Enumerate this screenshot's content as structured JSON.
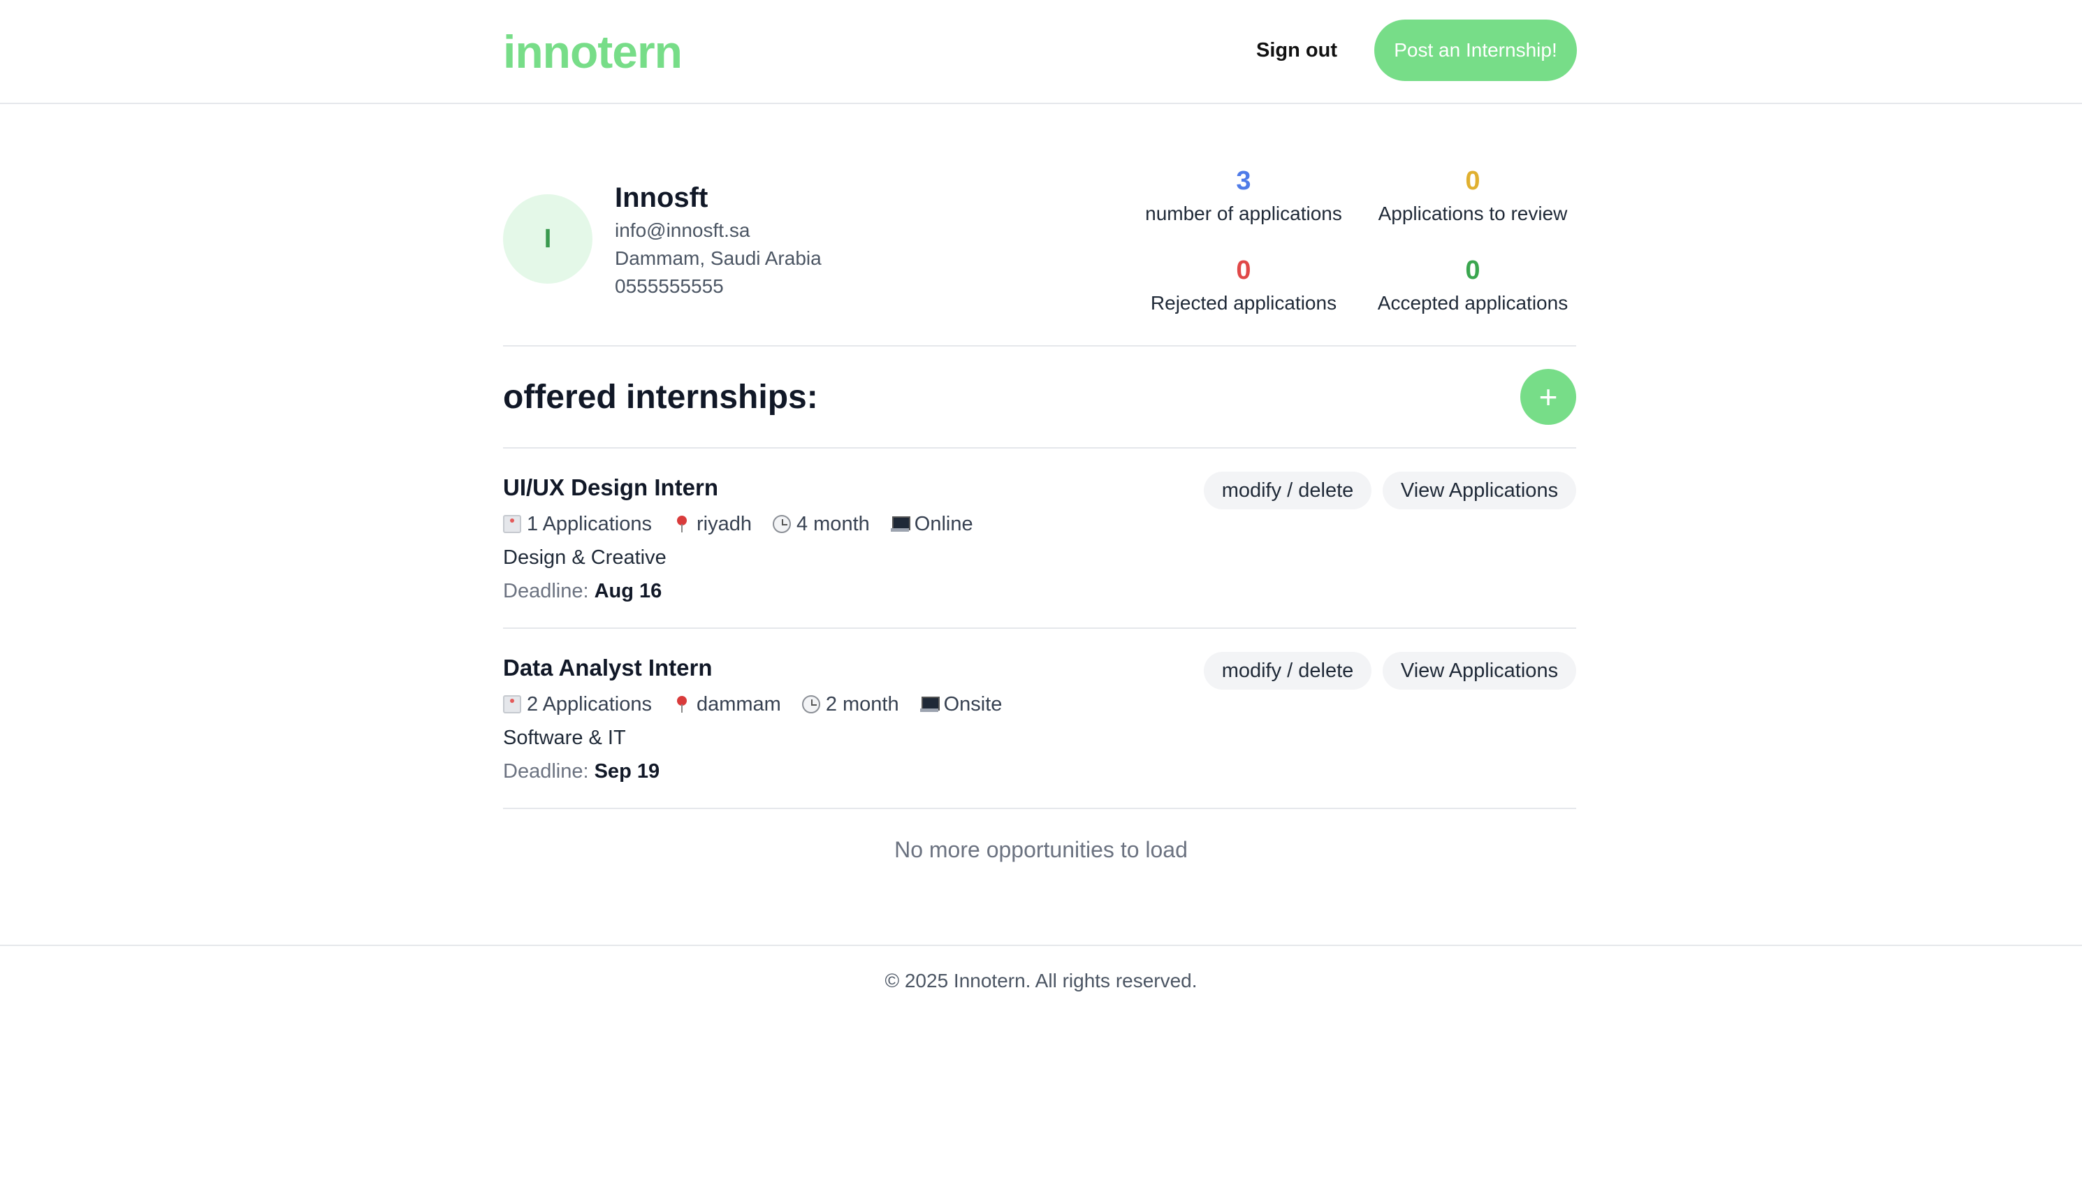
{
  "header": {
    "logo": "innotern",
    "signout_label": "Sign out",
    "post_label": "Post an Internship!"
  },
  "profile": {
    "avatar_initial": "I",
    "name": "Innosft",
    "email": "info@innosft.sa",
    "location": "Dammam, Saudi Arabia",
    "phone": "0555555555"
  },
  "stats": [
    {
      "value": "3",
      "label": "number of applications",
      "color": "#4f7be8"
    },
    {
      "value": "0",
      "label": "Applications to review",
      "color": "#e0b030"
    },
    {
      "value": "0",
      "label": "Rejected applications",
      "color": "#e04848"
    },
    {
      "value": "0",
      "label": "Accepted applications",
      "color": "#3aa64f"
    }
  ],
  "section": {
    "title": "offered internships:",
    "add_symbol": "+"
  },
  "internships": [
    {
      "title": "UI/UX Design Intern",
      "applications": "1 Applications",
      "location": "riyadh",
      "duration": "4 month",
      "mode": "Online",
      "category": "Design & Creative",
      "deadline_label": "Deadline:",
      "deadline": "Aug 16",
      "modify_label": "modify / delete",
      "view_label": "View Applications"
    },
    {
      "title": "Data Analyst Intern",
      "applications": "2 Applications",
      "location": "dammam",
      "duration": "2 month",
      "mode": "Onsite",
      "category": "Software & IT",
      "deadline_label": "Deadline:",
      "deadline": "Sep 19",
      "modify_label": "modify / delete",
      "view_label": "View Applications"
    }
  ],
  "no_more": "No more opportunities to load",
  "footer": "© 2025 Innotern. All rights reserved.",
  "colors": {
    "brand": "#77dd88",
    "avatar_bg": "#e4f8e8"
  }
}
